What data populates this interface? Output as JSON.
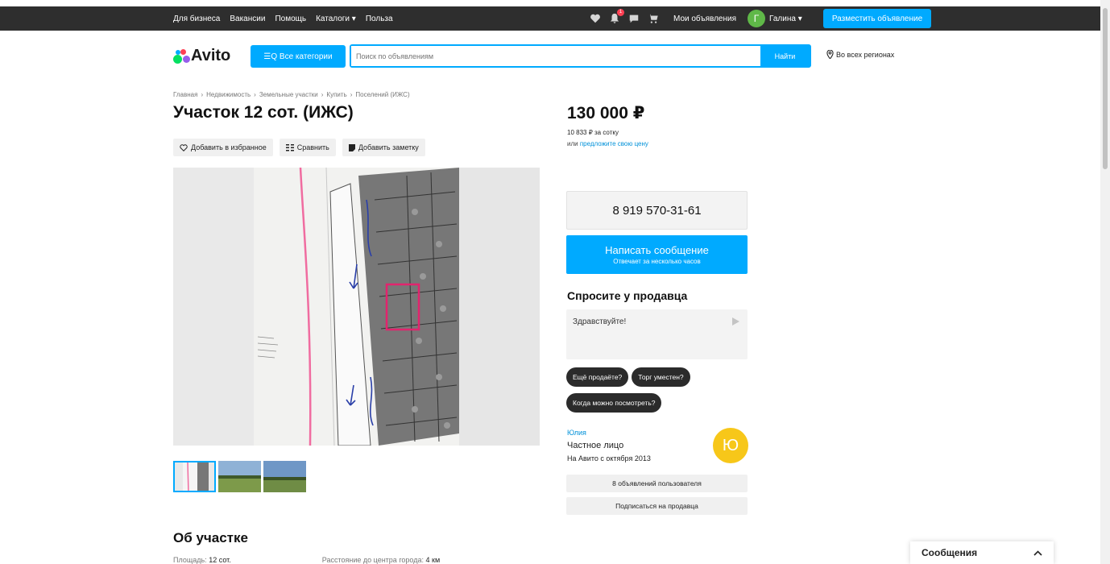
{
  "topbar": {
    "links": [
      "Для бизнеса",
      "Вакансии",
      "Помощь",
      "Каталоги ▾",
      "Польза"
    ],
    "notifications_badge": "1",
    "my_ads": "Мои объявления",
    "user_initial": "Г",
    "user_name": "Галина ▾",
    "post_button": "Разместить объявление"
  },
  "header": {
    "logo": "Avito",
    "categories_button": "☰Q Все категории",
    "search_placeholder": "Поиск по объявлениям",
    "search_button": "Найти",
    "region": "Во всех регионах"
  },
  "breadcrumbs": [
    "Главная",
    "Недвижимость",
    "Земельные участки",
    "Купить",
    "Поселений (ИЖС)"
  ],
  "listing": {
    "title": "Участок 12 сот. (ИЖС)",
    "actions": {
      "favorite": "Добавить в избранное",
      "compare": "Сравнить",
      "note": "Добавить заметку"
    },
    "price": "130 000 ₽",
    "price_per_unit": "10 833 ₽ за сотку",
    "offer_prefix": "или ",
    "offer_link": "предложите свою цену"
  },
  "contact": {
    "phone": "8 919 570-31-61",
    "message_button": "Написать сообщение",
    "message_sub": "Отвечает за несколько часов"
  },
  "ask": {
    "heading": "Спросите у продавца",
    "input_value": "Здравствуйте!",
    "chips": [
      "Ещё продаёте?",
      "Торг уместен?",
      "Когда можно посмотреть?"
    ]
  },
  "seller": {
    "name": "Юлия",
    "type": "Частное лицо",
    "since": "На Авито с октября 2013",
    "initial": "Ю",
    "ads_button": "8 объявлений пользователя",
    "subscribe_button": "Подписаться на продавца"
  },
  "about": {
    "heading": "Об участке",
    "area_label": "Площадь:",
    "area_value": "12 сот.",
    "distance_label": "Расстояние до центра города:",
    "distance_value": "4 км"
  },
  "messenger": {
    "label": "Сообщения"
  },
  "colors": {
    "accent": "#00aaff",
    "topbar": "#2e2e2e",
    "seller_avatar": "#f7c719",
    "user_avatar": "#5fb848"
  }
}
